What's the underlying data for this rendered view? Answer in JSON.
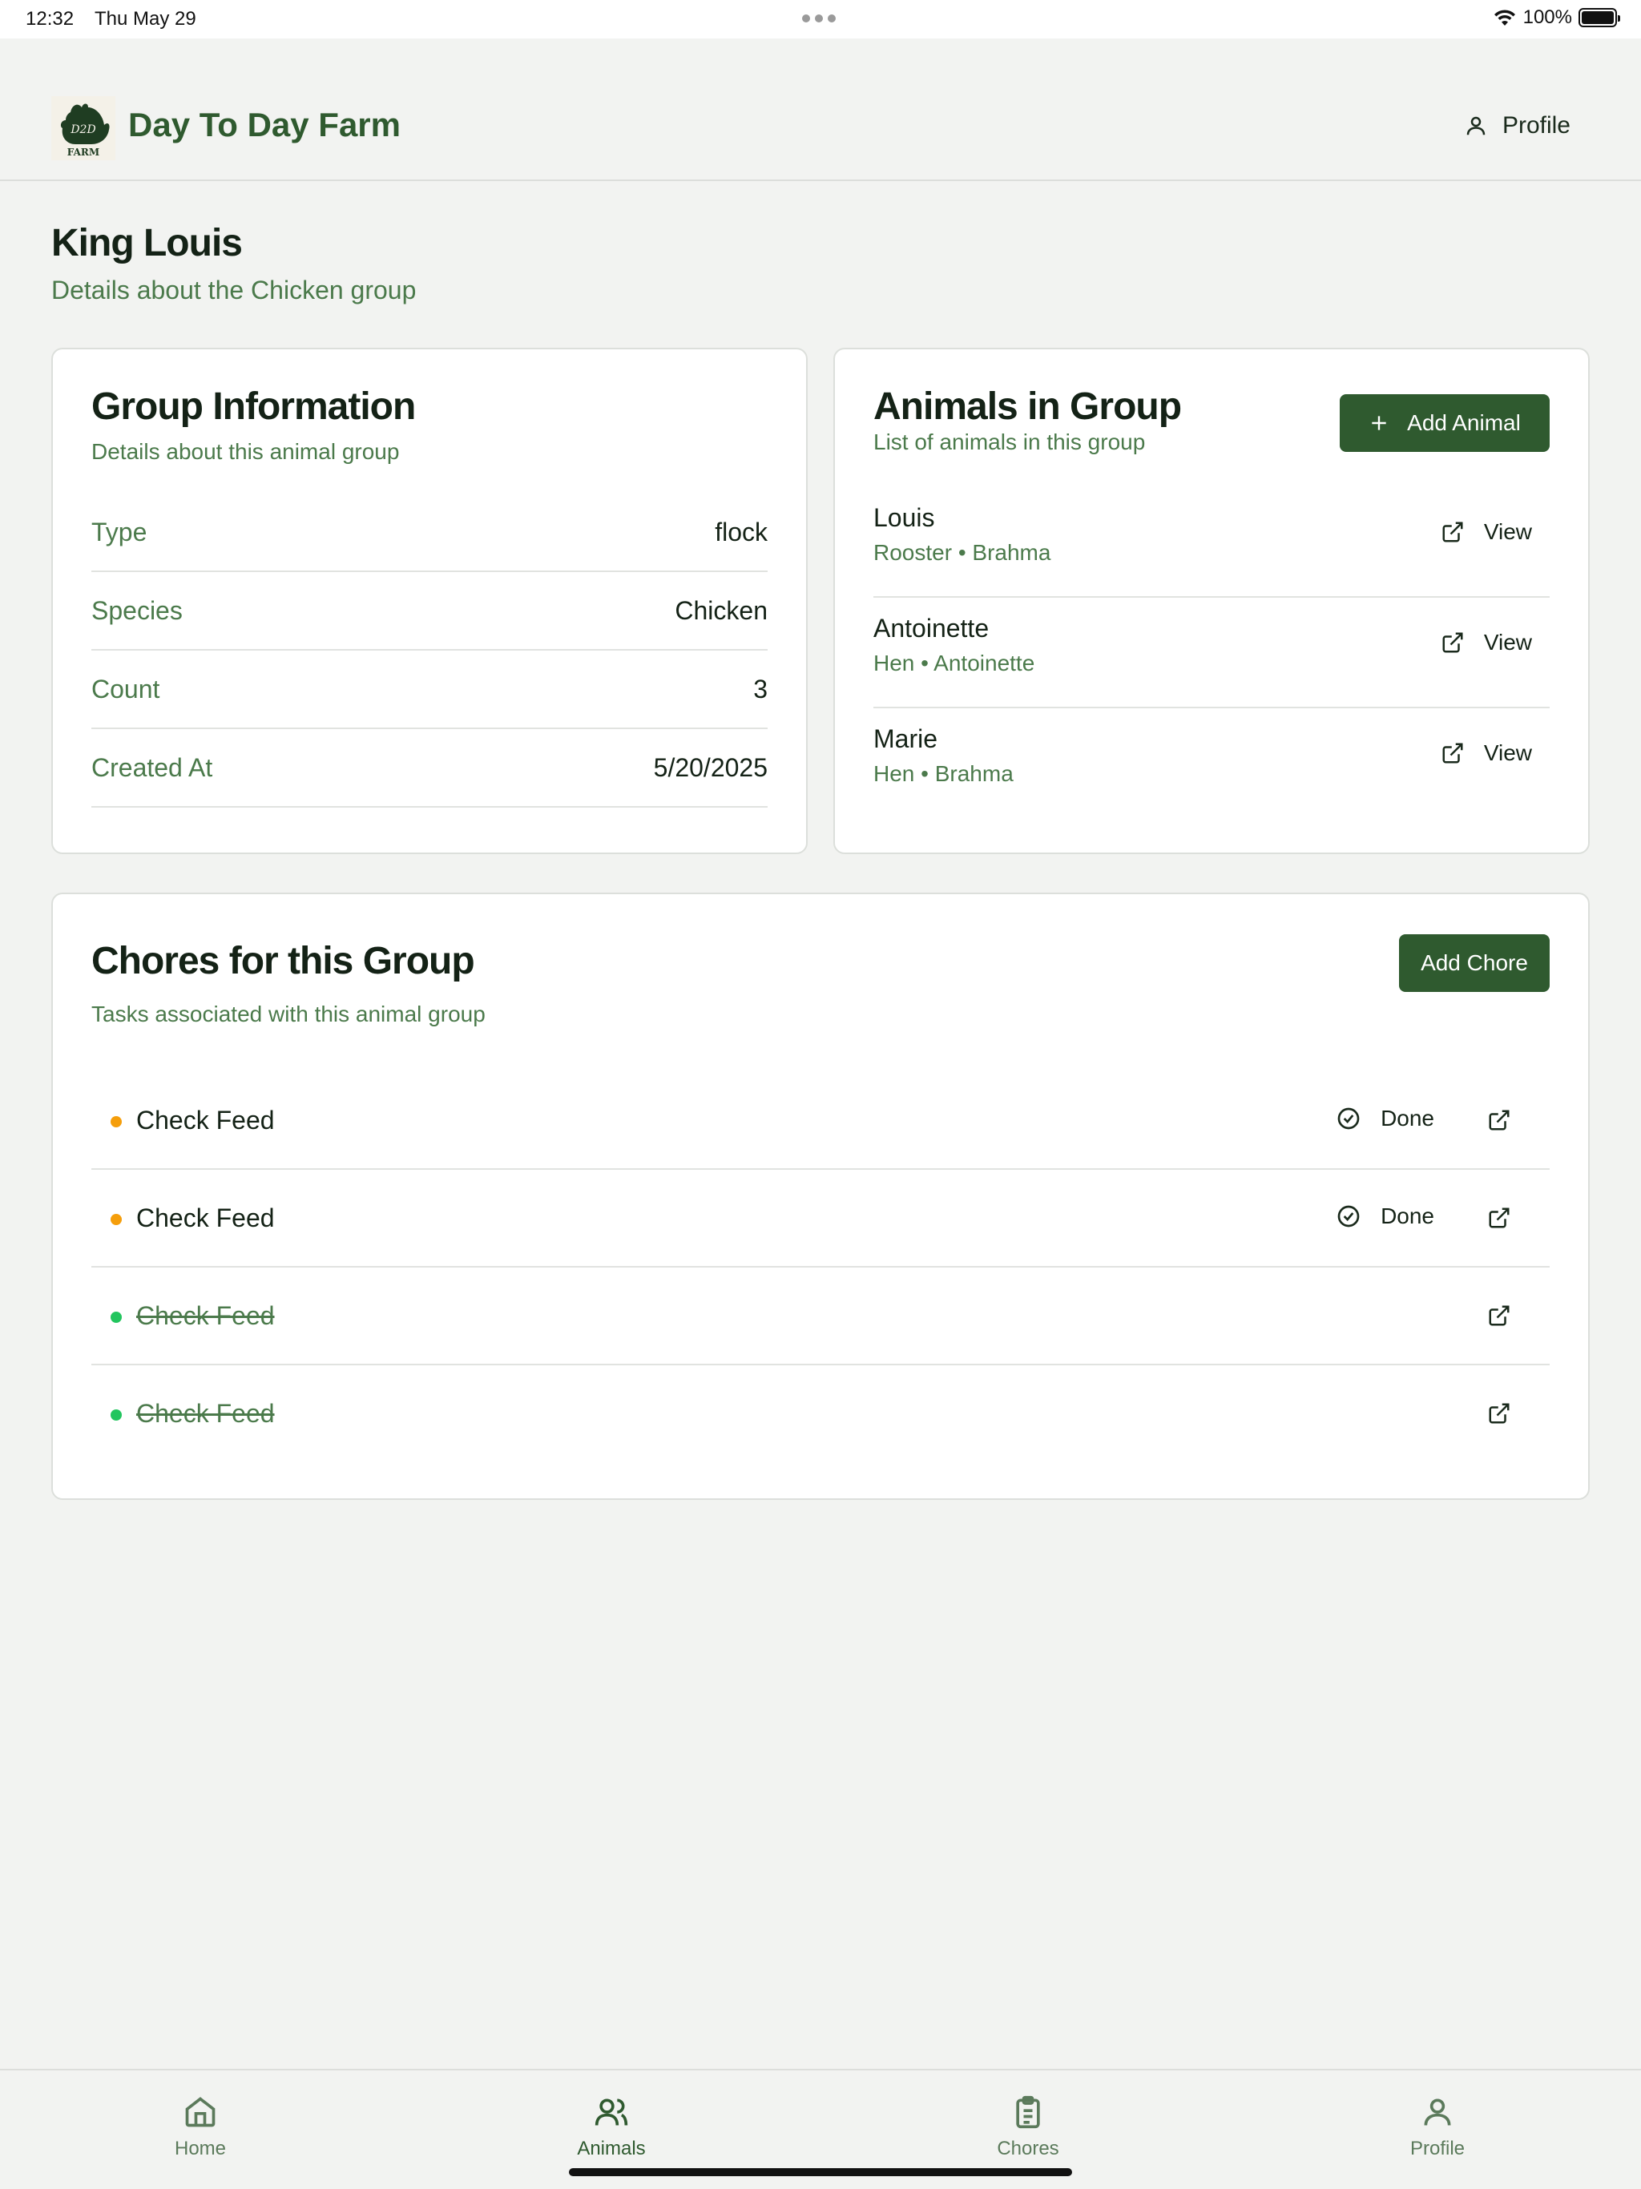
{
  "status_bar": {
    "time": "12:32",
    "date": "Thu May 29",
    "battery": "100%"
  },
  "header": {
    "brand": "Day To Day Farm",
    "profile_label": "Profile",
    "logo_text": "D2D",
    "logo_sub": "FARM"
  },
  "page": {
    "title": "King Louis",
    "subtitle": "Details about the Chicken group"
  },
  "group_info": {
    "title": "Group Information",
    "subtitle": "Details about this animal group",
    "rows": [
      {
        "label": "Type",
        "value": "flock"
      },
      {
        "label": "Species",
        "value": "Chicken"
      },
      {
        "label": "Count",
        "value": "3"
      },
      {
        "label": "Created At",
        "value": "5/20/2025"
      }
    ]
  },
  "animals": {
    "title": "Animals in Group",
    "subtitle": "List of animals in this group",
    "add_label": "Add Animal",
    "view_label": "View",
    "items": [
      {
        "name": "Louis",
        "meta": "Rooster • Brahma"
      },
      {
        "name": "Antoinette",
        "meta": "Hen • Antoinette"
      },
      {
        "name": "Marie",
        "meta": "Hen • Brahma"
      }
    ]
  },
  "chores": {
    "title": "Chores for this Group",
    "subtitle": "Tasks associated with this animal group",
    "add_label": "Add Chore",
    "done_label": "Done",
    "items": [
      {
        "name": "Check Feed",
        "status": "pending",
        "color": "#f59e0b"
      },
      {
        "name": "Check Feed",
        "status": "pending",
        "color": "#f59e0b"
      },
      {
        "name": "Check Feed",
        "status": "completed",
        "color": "#22c55e"
      },
      {
        "name": "Check Feed",
        "status": "completed",
        "color": "#22c55e"
      }
    ]
  },
  "nav": {
    "items": [
      {
        "label": "Home",
        "icon": "home-icon"
      },
      {
        "label": "Animals",
        "icon": "users-icon",
        "active": true
      },
      {
        "label": "Chores",
        "icon": "clipboard-icon"
      },
      {
        "label": "Profile",
        "icon": "user-icon"
      }
    ]
  },
  "colors": {
    "accent": "#2f5a2f",
    "muted_green": "#4b7a4b",
    "background": "#f2f3f1"
  }
}
